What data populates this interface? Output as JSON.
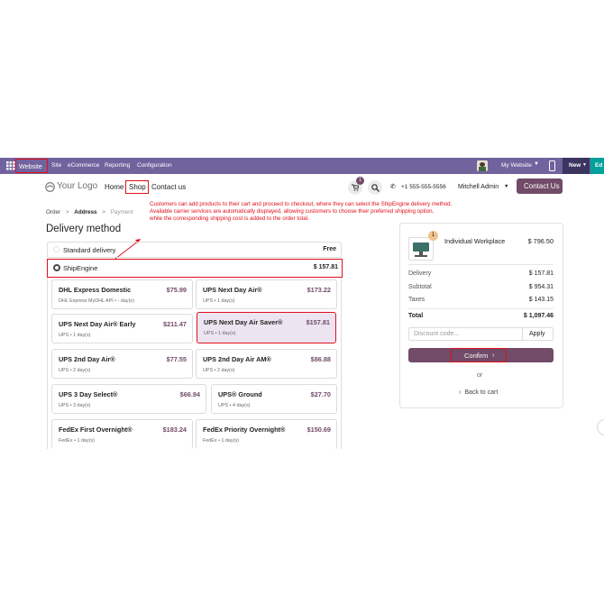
{
  "topbar": {
    "app_name": "Website",
    "menus": [
      "Site",
      "eCommerce",
      "Reporting",
      "Configuration"
    ],
    "website_selector": "My Website",
    "new_button": "New",
    "edit_button": "Ed"
  },
  "header": {
    "logo_text": "Your Logo",
    "nav": [
      "Home",
      "Shop",
      "Contact us"
    ],
    "cart_count": "1",
    "phone": "+1 555-555-5556",
    "user": "Mitchell Admin",
    "contact_button": "Contact Us"
  },
  "annotation": {
    "lines": [
      "Customers can add products to their cart and proceed to checkout, where they can select the ShipEngine delivery method.",
      "Available carrier services are automatically displayed, allowing customers to choose their preferred shipping option,",
      "while the corresponding shipping cost is added to the order total."
    ]
  },
  "breadcrumb": [
    "Order",
    "Address",
    "Payment"
  ],
  "page_title": "Delivery method",
  "delivery_options": [
    {
      "label": "Standard delivery",
      "price": "Free",
      "selected": false
    },
    {
      "label": "ShipEngine",
      "price": "$ 157.81",
      "selected": true
    }
  ],
  "carriers": [
    {
      "name": "DHL Express Domestic",
      "sub": "DHL Express MyDHL API • - day(s)",
      "price": "$75.99"
    },
    {
      "name": "UPS Next Day Air®",
      "sub": "UPS • 1 day(s)",
      "price": "$173.22"
    },
    {
      "name": "UPS Next Day Air® Early",
      "sub": "UPS • 1 day(s)",
      "price": "$211.47"
    },
    {
      "name": "UPS Next Day Air Saver®",
      "sub": "UPS • 1 day(s)",
      "price": "$157.81"
    },
    {
      "name": "UPS 2nd Day Air®",
      "sub": "UPS • 2 day(s)",
      "price": "$77.55"
    },
    {
      "name": "UPS 2nd Day Air AM®",
      "sub": "UPS • 2 day(s)",
      "price": "$86.88"
    },
    {
      "name": "UPS 3 Day Select®",
      "sub": "UPS • 3 day(s)",
      "price": "$66.94"
    },
    {
      "name": "UPS® Ground",
      "sub": "UPS • 4 day(s)",
      "price": "$27.70"
    },
    {
      "name": "FedEx First Overnight®",
      "sub": "FedEx • 1 day(s)",
      "price": "$183.24"
    },
    {
      "name": "FedEx Priority Overnight®",
      "sub": "FedEx • 1 day(s)",
      "price": "$150.69"
    }
  ],
  "summary": {
    "product_qty": "1",
    "product_name": "Individual Workplace",
    "product_price": "$ 796.50",
    "delivery_label": "Delivery",
    "delivery_value": "$ 157.81",
    "subtotal_label": "Subtotal",
    "subtotal_value": "$ 954.31",
    "taxes_label": "Taxes",
    "taxes_value": "$ 143.15",
    "total_label": "Total",
    "total_value": "$ 1,097.46",
    "discount_placeholder": "Discount code...",
    "apply_label": "Apply",
    "confirm_label": "Confirm",
    "or_label": "or",
    "back_label": "Back to cart"
  },
  "colors": {
    "topbar": "#71639e",
    "accent": "#714b67",
    "annotation": "#e0101a",
    "selected_card": "#ece4f0"
  }
}
